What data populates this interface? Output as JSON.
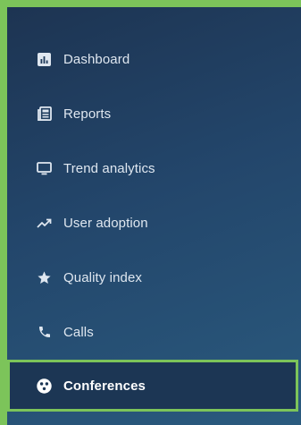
{
  "colors": {
    "accent": "#7cc45a",
    "sidebar_bg": "#1d3452",
    "text": "#dfe7f0",
    "active_text": "#ffffff"
  },
  "nav": {
    "items": [
      {
        "label": "Dashboard",
        "icon": "bar-chart-icon"
      },
      {
        "label": "Reports",
        "icon": "reports-icon"
      },
      {
        "label": "Trend analytics",
        "icon": "monitor-icon"
      },
      {
        "label": "User adoption",
        "icon": "trending-up-icon"
      },
      {
        "label": "Quality index",
        "icon": "star-icon"
      },
      {
        "label": "Calls",
        "icon": "phone-icon"
      },
      {
        "label": "Conferences",
        "icon": "conference-icon",
        "active": true
      }
    ]
  }
}
